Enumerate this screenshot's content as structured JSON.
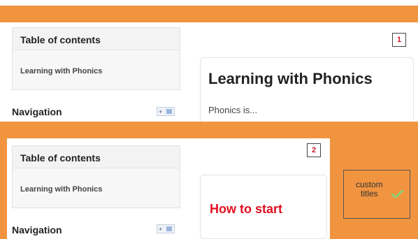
{
  "panel1": {
    "toc_title": "Table of contents",
    "toc_item": "Learning with Phonics",
    "nav_title": "Navigation",
    "badge": "1",
    "heading": "Learning with Phonics",
    "paragraph": "Phonics is..."
  },
  "panel2": {
    "toc_title": "Table of contents",
    "toc_item": "Learning with Phonics",
    "nav_title": "Navigation",
    "badge": "2",
    "heading": "How to start"
  },
  "callout": {
    "text_line1": "custom",
    "text_line2": "titles"
  },
  "colors": {
    "orange": "#f19440",
    "heading_red": "#e0101f",
    "badge_red": "#d0142c",
    "check_green": "#8ccf73"
  },
  "icons": {
    "nav_dock": "dock-icon",
    "check": "check-icon"
  }
}
